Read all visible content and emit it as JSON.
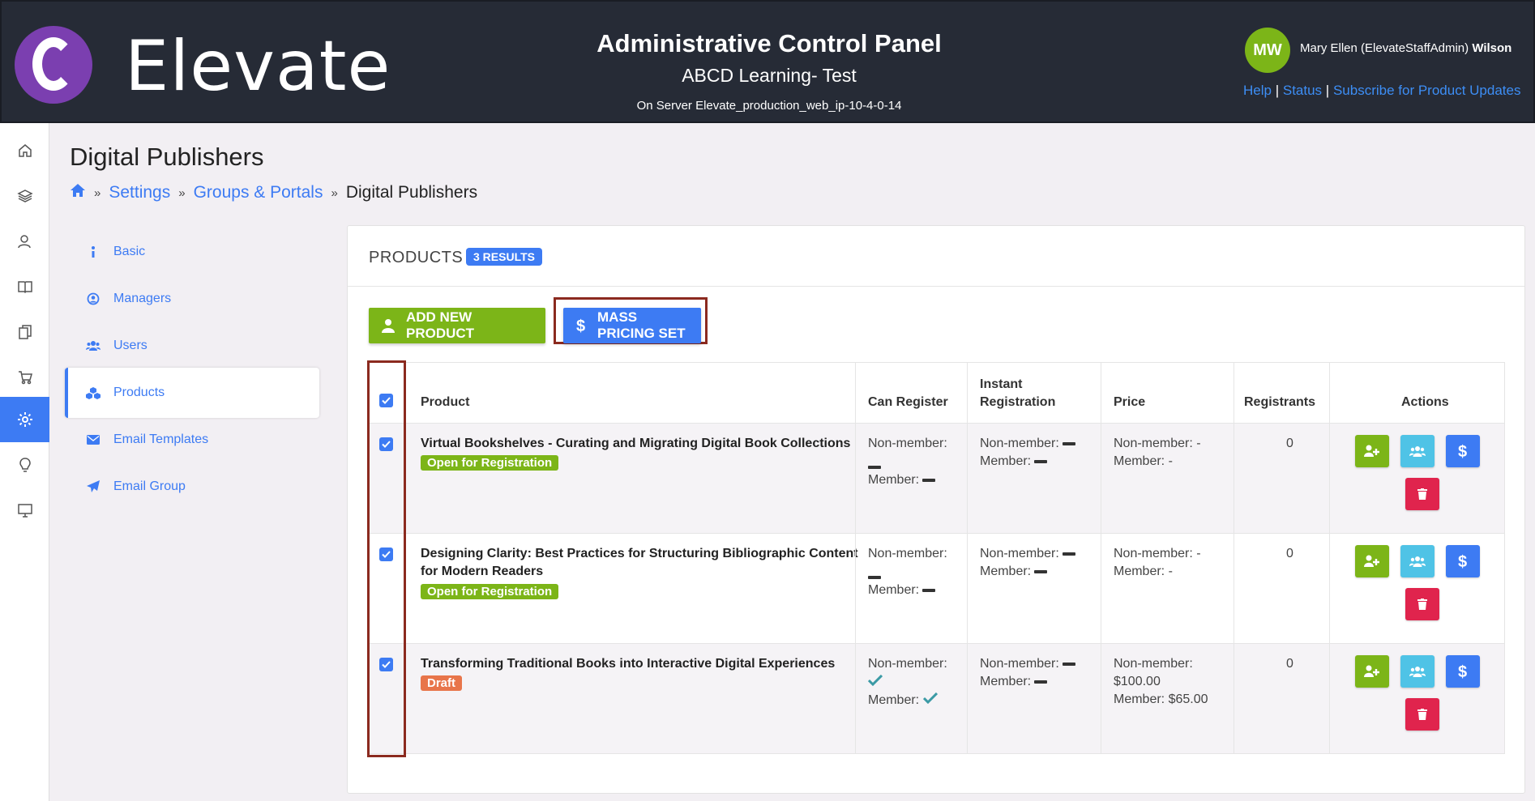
{
  "header": {
    "logo_letter": "C",
    "brand": "Elevate",
    "title": "Administrative Control Panel",
    "subtitle": "ABCD Learning- Test",
    "server": "On Server Elevate_production_web_ip-10-4-0-14",
    "avatar_initials": "MW",
    "user_name_prefix": "Mary Ellen (ElevateStaffAdmin)",
    "user_name_last": "Wilson",
    "links": {
      "help": "Help",
      "status": "Status",
      "subscribe": "Subscribe for Product Updates",
      "sep": "|"
    }
  },
  "iconbar": [
    "home-icon",
    "layers-icon",
    "users-icon",
    "book-icon",
    "documents-icon",
    "cart-icon",
    "settings-icon",
    "lightbulb-icon",
    "monitor-icon"
  ],
  "page": {
    "title": "Digital Publishers",
    "breadcrumb": {
      "settings": "Settings",
      "groups": "Groups & Portals",
      "current": "Digital Publishers",
      "sep": "»"
    }
  },
  "sidemenu": {
    "basic": "Basic",
    "managers": "Managers",
    "users": "Users",
    "products": "Products",
    "email_templates": "Email Templates",
    "email_group": "Email Group"
  },
  "products": {
    "title": "PRODUCTS",
    "results": "3 RESULTS",
    "add_button": "ADD NEW PRODUCT",
    "mass_button": "MASS PRICING SET",
    "columns": {
      "product": "Product",
      "can_register": "Can Register",
      "instant_1": "Instant",
      "instant_2": "Registration",
      "price": "Price",
      "registrants": "Registrants",
      "actions": "Actions"
    },
    "rows": [
      {
        "name_1": "Virtual Bookshelves - Curating and Migrating Digital Book Collections",
        "name_2": "",
        "status": "Open for Registration",
        "can_nonmember": "Non-member:",
        "can_member": "Member:",
        "inst_nonmember": "Non-member:",
        "inst_member": "Member:",
        "price_nonmember": "Non-member: -",
        "price_member": "Member: -",
        "registrants": "0"
      },
      {
        "name_1": "Designing Clarity: Best Practices for Structuring Bibliographic Content",
        "name_2": "for Modern Readers",
        "status": "Open for Registration",
        "can_nonmember": "Non-member:",
        "can_member": "Member:",
        "inst_nonmember": "Non-member:",
        "inst_member": "Member:",
        "price_nonmember": "Non-member: -",
        "price_member": "Member: -",
        "registrants": "0"
      },
      {
        "name_1": "Transforming Traditional Books into Interactive Digital Experiences",
        "name_2": "",
        "status": "Draft",
        "can_nonmember": "Non-member:",
        "can_member": "Member:",
        "inst_nonmember": "Non-member:",
        "inst_member": "Member:",
        "price_nonmember": "Non-member:",
        "price_nonmember_value": "$100.00",
        "price_member": "Member: $65.00",
        "registrants": "0"
      }
    ]
  },
  "colors": {
    "primary": "#3d7bf3",
    "green": "#7cb518",
    "teal": "#4fc3e6",
    "red": "#e0244d",
    "draft": "#e8754a",
    "highlight": "#8b2a1f"
  }
}
